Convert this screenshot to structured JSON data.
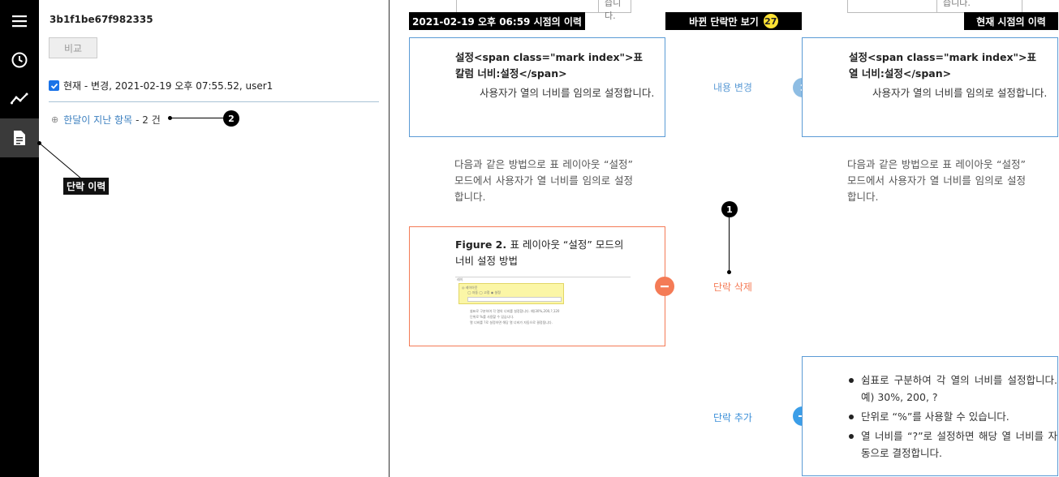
{
  "rail": {
    "icons": [
      "menu-icon",
      "history-clock-icon",
      "chart-trend-icon",
      "document-icon"
    ]
  },
  "panel": {
    "revision_id": "3b1f1be67f982335",
    "compare_label": "비교",
    "current_revision": "현재 - 변경, 2021-02-19 오후 07:55.52, user1",
    "older_link": "한달이 지난 항목",
    "older_count": "- 2 건",
    "callout_2": "2",
    "tooltip": "단락 이력"
  },
  "compare": {
    "left_header": "2021-02-19 오후 06:59 시점의 이력",
    "center_header": "바뀐 단락만 보기",
    "changes_count": "27",
    "right_header": "현재 시점의 이력",
    "stub_text": "습니다.",
    "callout_1": "1",
    "rows": {
      "modified": {
        "label": "내용 변경",
        "left_title_1": "설정<span class=\"mark index\">표",
        "left_title_2": "칼럼 너비:설정</span>",
        "right_title_1": "설정<span class=\"mark index\">표",
        "right_title_2": "열 너비:설정</span>",
        "desc": "사용자가 열의 너비를 임의로 설정합니다."
      },
      "unchanged": {
        "text": "다음과 같은 방법으로 표 레이아웃 “설정” 모드에서 사용자가 열 너비를 임의로 설정합니다."
      },
      "deleted": {
        "label": "단락 삭제",
        "figure_label": "Figure 2.",
        "figure_title_1": "표 레이아웃 “설정” 모드의",
        "figure_title_2": "너비 설정 방법",
        "mini_heading": "레이",
        "mini_option_title": "◎ 레이아웃",
        "mini_options": "◯ 자동  ◯ 고정  ◉ 설정",
        "mini_notes": [
          "쉼표로 구분하여 각 열의 너비를 설정합니다. 예)30%,200,?,120",
          "단위로 %를 사용할 수 있습니다.",
          "열 너비를 ?로 설정하면 해당 열 너비가 자동으로 결정됩니다."
        ]
      },
      "added": {
        "label": "단락 추가",
        "items": [
          "쉼표로 구분하여 각 열의 너비를 설정합니다. 예) 30%, 200, ?",
          "단위로 “%”를 사용할 수 있습니다.",
          "열 너비를 “?”로 설정하면 해당 열 너비를 자동으로 결정합니다."
        ]
      }
    }
  },
  "colors": {
    "rail_bg": "#000000",
    "modified_blue": "#5b9bd5",
    "deleted_orange": "#f47b56",
    "added_blue": "#3b8fd8",
    "badge_yellow": "#ffe234"
  }
}
